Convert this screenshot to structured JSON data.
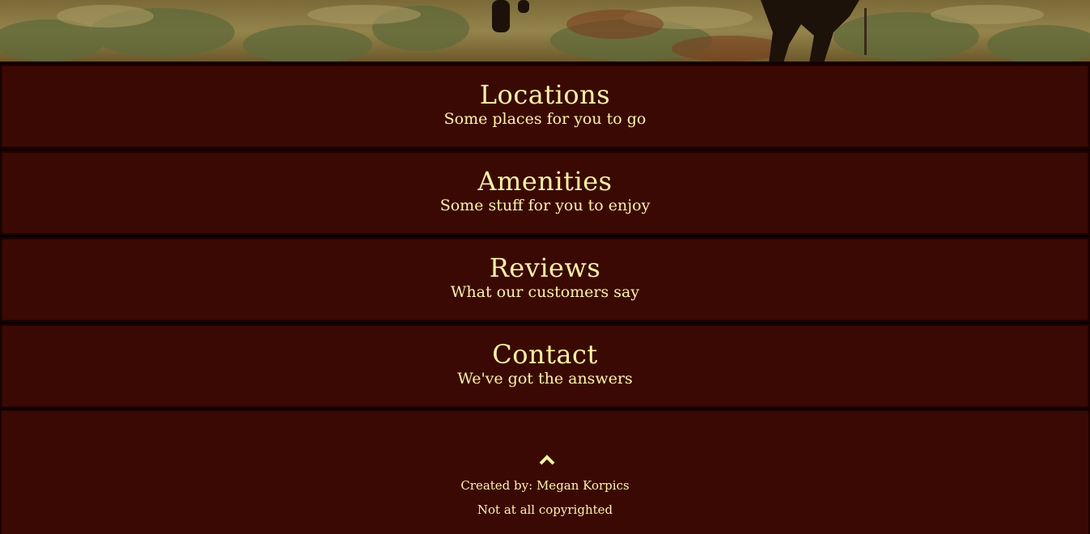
{
  "theme": {
    "section_bg": "#3a0904",
    "text_color": "#fff79a",
    "border_color": "#1a0200"
  },
  "hero": {
    "image": "desert-horses-photo"
  },
  "sections": [
    {
      "title": "Locations",
      "subtitle": "Some places for you to go"
    },
    {
      "title": "Amenities",
      "subtitle": "Some stuff for you to enjoy"
    },
    {
      "title": "Reviews",
      "subtitle": "What our customers say"
    },
    {
      "title": "Contact",
      "subtitle": "We've got the answers"
    }
  ],
  "footer": {
    "up_icon": "chevron-up-icon",
    "credit": "Created by: Megan Korpics",
    "copyright": "Not at all copyrighted"
  }
}
